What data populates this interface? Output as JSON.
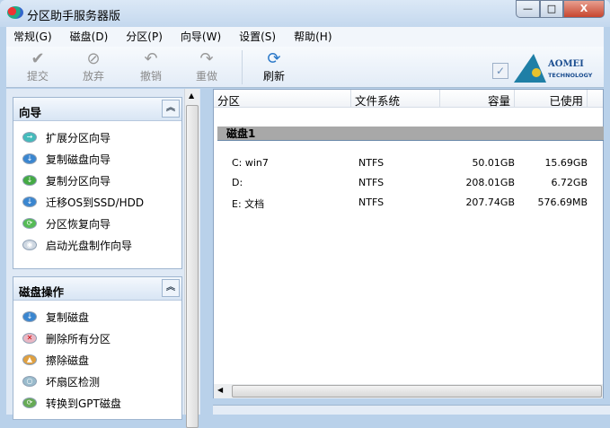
{
  "window": {
    "title": "分区助手服务器版",
    "min": "—",
    "max": "□",
    "close": "X"
  },
  "menu": [
    "常规(G)",
    "磁盘(D)",
    "分区(P)",
    "向导(W)",
    "设置(S)",
    "帮助(H)"
  ],
  "toolbar": {
    "commit": "提交",
    "discard": "放弃",
    "undo": "撤销",
    "redo": "重做",
    "refresh": "刷新"
  },
  "logo": {
    "brand": "AOMEI",
    "sub": "TECHNOLOGY"
  },
  "wizards": {
    "title": "向导",
    "items": [
      "扩展分区向导",
      "复制磁盘向导",
      "复制分区向导",
      "迁移OS到SSD/HDD",
      "分区恢复向导",
      "启动光盘制作向导"
    ]
  },
  "disk_ops": {
    "title": "磁盘操作",
    "items": [
      "复制磁盘",
      "删除所有分区",
      "擦除磁盘",
      "坏扇区检测",
      "转换到GPT磁盘"
    ]
  },
  "table": {
    "headers": [
      "分区",
      "文件系统",
      "容量",
      "已使用"
    ],
    "disk": "磁盘1",
    "rows": [
      [
        "C: win7",
        "NTFS",
        "50.01GB",
        "15.69GB"
      ],
      [
        "D:",
        "NTFS",
        "208.01GB",
        "6.72GB"
      ],
      [
        "E: 文档",
        "NTFS",
        "207.74GB",
        "576.69MB"
      ]
    ]
  }
}
